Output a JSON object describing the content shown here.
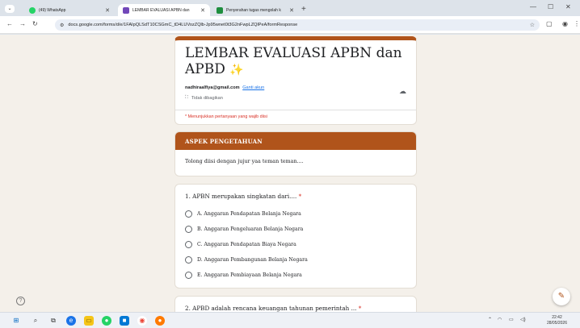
{
  "browser": {
    "tabs": [
      {
        "title": "(49) WhatsApp",
        "favicon": "whatsapp-icon",
        "color": "#25d366",
        "active": false
      },
      {
        "title": "LEMBAR EVALUASI APBN dan",
        "favicon": "google-forms-icon",
        "color": "#7248b9",
        "active": true
      },
      {
        "title": "Penyerahan tugas mengolah k",
        "favicon": "classroom-icon",
        "color": "#1e8e3e",
        "active": false
      }
    ],
    "new_tab": "+",
    "url": "docs.google.com/forms/d/e/1FAIpQLSdT10CSGmC_tD4LUVozZQlb-Jp95wnet0t3G2nFwpLZQlPeA/formResponse"
  },
  "form": {
    "title": "LEMBAR EVALUASI APBN dan APBD",
    "title_emoji": "✨",
    "email": "nadhiraalfiya@gmail.com",
    "switch_account": "Ganti akun",
    "not_shared": "Tidak dibagikan",
    "required_note": "* Menunjukkan pertanyaan yang wajib diisi",
    "section_title": "ASPEK PENGETAHUAN",
    "section_desc": "Tolong diisi dengan jujur yaa teman teman....",
    "q1": {
      "title": "1. APBN merupakan singkatan dari.... ",
      "required_mark": "*",
      "options": [
        "A. Anggaran Pendapatan Belanja Negara",
        "B. Anggaran Pengeluaran Belanja Negara",
        "C. Anggaran Pendapatan Biaya Negara",
        "D. Anggaran Pembangunan Belanja Negara",
        "E. Anggaran Pembiayaan Belanja Negara"
      ]
    },
    "q2": {
      "title": "2. APBD adalah rencana keuangan tahunan pemerintah ... ",
      "required_mark": "*"
    }
  },
  "help_icon": "?",
  "taskbar": {
    "time": "22:42",
    "date": "28/05/2026"
  },
  "colors": {
    "accent": "#b0541b",
    "page_bg": "#f4f0ea",
    "required": "#d93025"
  }
}
